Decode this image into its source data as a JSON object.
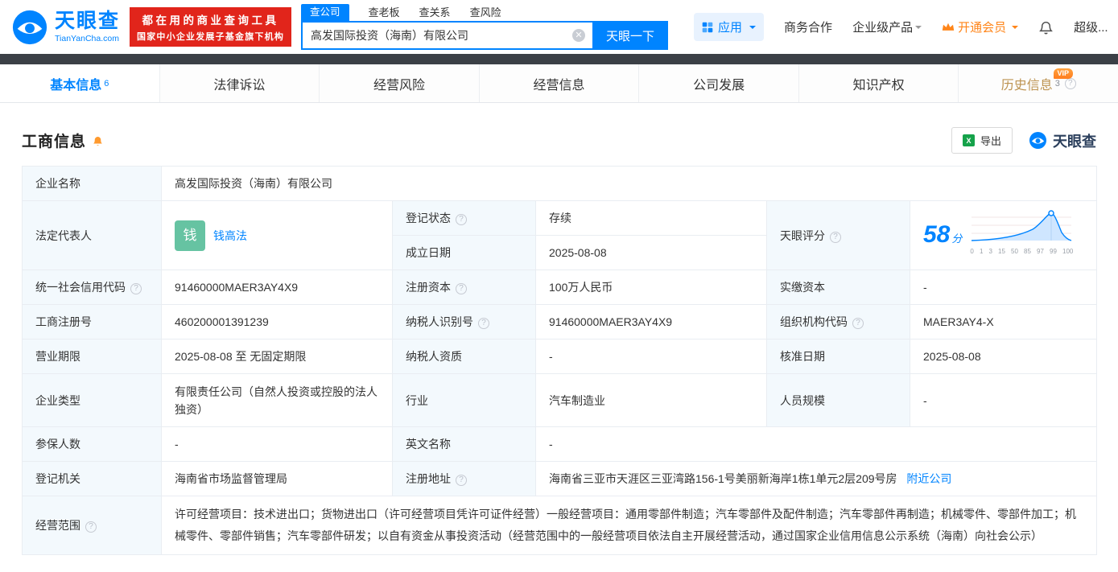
{
  "header": {
    "logo": {
      "name": "天眼查",
      "domain": "TianYanCha.com"
    },
    "badge": {
      "line1": "都在用的商业查询工具",
      "line2": "国家中小企业发展子基金旗下机构"
    },
    "search": {
      "tabs": [
        {
          "label": "查公司"
        },
        {
          "label": "查老板"
        },
        {
          "label": "查关系"
        },
        {
          "label": "查风险"
        }
      ],
      "input_value": "高发国际投资（海南）有限公司",
      "search_button": "天眼一下"
    },
    "nav": {
      "apps": "应用",
      "cooperation": "商务合作",
      "enterprise": "企业级产品",
      "vip": "开通会员",
      "super": "超级..."
    }
  },
  "tabs": {
    "basic": {
      "label": "基本信息",
      "count": "6"
    },
    "legal": {
      "label": "法律诉讼"
    },
    "risk": {
      "label": "经营风险"
    },
    "operation": {
      "label": "经营信息"
    },
    "development": {
      "label": "公司发展"
    },
    "ip": {
      "label": "知识产权"
    },
    "history": {
      "label": "历史信息",
      "count": "3",
      "vip_badge": "VIP"
    }
  },
  "section": {
    "title": "工商信息",
    "export": "导出",
    "brand": "天眼查"
  },
  "info": {
    "company_name": {
      "label": "企业名称",
      "value": "高发国际投资（海南）有限公司"
    },
    "legal_rep": {
      "label": "法定代表人",
      "avatar": "钱",
      "name": "钱高法"
    },
    "reg_status": {
      "label": "登记状态",
      "value": "存续"
    },
    "establish_date": {
      "label": "成立日期",
      "value": "2025-08-08"
    },
    "score": {
      "label": "天眼评分",
      "value": "58",
      "unit": "分",
      "ticks": [
        "0",
        "1",
        "3",
        "15",
        "50",
        "85",
        "97",
        "99",
        "100"
      ]
    },
    "credit_code": {
      "label": "统一社会信用代码",
      "value": "91460000MAER3AY4X9"
    },
    "reg_capital": {
      "label": "注册资本",
      "value": "100万人民币"
    },
    "paid_capital": {
      "label": "实缴资本",
      "value": "-"
    },
    "reg_number": {
      "label": "工商注册号",
      "value": "460200001391239"
    },
    "taxpayer_id": {
      "label": "纳税人识别号",
      "value": "91460000MAER3AY4X9"
    },
    "org_code": {
      "label": "组织机构代码",
      "value": "MAER3AY4-X"
    },
    "business_term": {
      "label": "营业期限",
      "value": "2025-08-08 至 无固定期限"
    },
    "taxpayer_quality": {
      "label": "纳税人资质",
      "value": "-"
    },
    "approval_date": {
      "label": "核准日期",
      "value": "2025-08-08"
    },
    "company_type": {
      "label": "企业类型",
      "value": "有限责任公司（自然人投资或控股的法人独资）"
    },
    "industry": {
      "label": "行业",
      "value": "汽车制造业"
    },
    "staff_size": {
      "label": "人员规模",
      "value": "-"
    },
    "insured_count": {
      "label": "参保人数",
      "value": "-"
    },
    "english_name": {
      "label": "英文名称",
      "value": "-"
    },
    "reg_authority": {
      "label": "登记机关",
      "value": "海南省市场监督管理局"
    },
    "reg_address": {
      "label": "注册地址",
      "value": "海南省三亚市天涯区三亚湾路156-1号美丽新海岸1栋1单元2层209号房",
      "link": "附近公司"
    },
    "business_scope": {
      "label": "经营范围",
      "value": "许可经营项目：技术进出口；货物进出口（许可经营项目凭许可证件经营）一般经营项目：通用零部件制造；汽车零部件及配件制造；汽车零部件再制造；机械零件、零部件加工；机械零件、零部件销售；汽车零部件研发；以自有资金从事投资活动（经营范围中的一般经营项目依法自主开展经营活动，通过国家企业信用信息公示系统（海南）向社会公示）"
    }
  },
  "colors": {
    "brand_blue": "#0084ff",
    "status_green": "#00b15b",
    "history_gold": "#bd9351",
    "badge_red": "#e1251b",
    "member_orange": "#ff8519"
  }
}
